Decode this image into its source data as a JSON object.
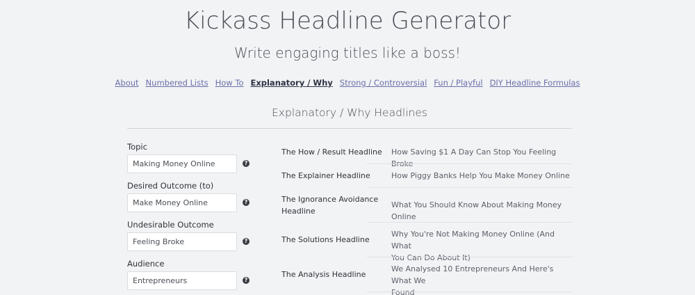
{
  "header": {
    "title": "Kickass Headline Generator",
    "subtitle": "Write engaging titles like a boss!"
  },
  "nav": {
    "items": [
      {
        "label": "About",
        "active": false
      },
      {
        "label": "Numbered Lists",
        "active": false
      },
      {
        "label": "How To",
        "active": false
      },
      {
        "label": "Explanatory / Why",
        "active": true
      },
      {
        "label": "Strong / Controversial",
        "active": false
      },
      {
        "label": "Fun / Playful",
        "active": false
      },
      {
        "label": "DIY Headline Formulas",
        "active": false
      }
    ]
  },
  "section": {
    "title": "Explanatory / Why Headlines"
  },
  "form": {
    "fields": [
      {
        "label": "Topic",
        "value": "Making Money Online",
        "help_icon": "question-circle-icon"
      },
      {
        "label": "Desired Outcome (to)",
        "value": "Make Money Online",
        "help_icon": "question-circle-icon"
      },
      {
        "label": "Undesirable Outcome",
        "value": "Feeling Broke",
        "help_icon": "question-circle-icon"
      },
      {
        "label": "Audience",
        "value": "Entrepreneurs",
        "help_icon": "question-circle-icon"
      }
    ]
  },
  "headlines": [
    {
      "type_lines": [
        "The How / Result Headline"
      ],
      "example_lines": [
        "How Saving $1 A Day Can Stop You Feeling Broke"
      ]
    },
    {
      "type_lines": [
        "The Explainer Headline"
      ],
      "example_lines": [
        "How Piggy Banks Help You Make Money Online"
      ]
    },
    {
      "type_lines": [
        "The Ignorance Avoidance",
        "Headline"
      ],
      "example_lines": [
        "What You Should Know About Making Money Online"
      ]
    },
    {
      "type_lines": [
        "The Solutions Headline"
      ],
      "example_lines": [
        "Why You're Not Making Money Online (And What",
        "You Can Do About It)"
      ]
    },
    {
      "type_lines": [
        "The Analysis Headline"
      ],
      "example_lines": [
        "We Analysed 10 Entrepreneurs And Here's What We",
        "Found"
      ]
    }
  ],
  "colors": {
    "background": "#f2f3f5",
    "link": "#6b6fa8",
    "active_link": "#2f3244"
  }
}
